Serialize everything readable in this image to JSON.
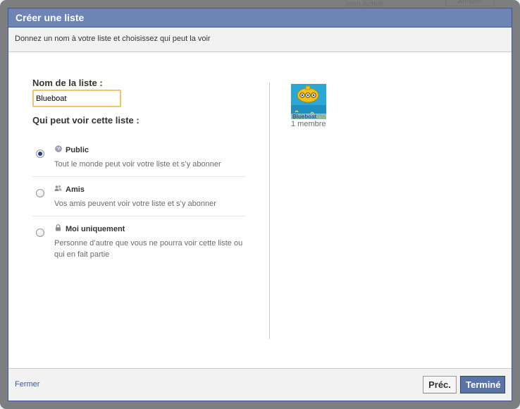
{
  "background": {
    "ghost_name": "Jean Activit",
    "ghost_button": "Annuler"
  },
  "dialog": {
    "title": "Créer une liste",
    "subtitle": "Donnez un nom à votre liste et choisissez qui peut la voir"
  },
  "form": {
    "name_label": "Nom de la liste :",
    "name_value": "Blueboat",
    "visibility_label": "Qui peut voir cette liste :",
    "options": [
      {
        "title": "Public",
        "description": "Tout le monde peut voir votre liste et s’y abonner",
        "icon": "globe-icon",
        "selected": true
      },
      {
        "title": "Amis",
        "description": "Vos amis peuvent voir votre liste et s’y abonner",
        "icon": "friends-icon",
        "selected": false
      },
      {
        "title": "Moi uniquement",
        "description": "Personne d’autre que vous ne pourra voir cette liste ou qui en fait partie",
        "icon": "lock-icon",
        "selected": false
      }
    ]
  },
  "members": {
    "thumbnail_caption": "Blueboat",
    "count": "1 membre"
  },
  "footer": {
    "close_label": "Fermer",
    "prev_label": "Préc.",
    "done_label": "Terminé"
  },
  "colors": {
    "header_bg": "#6d84b4",
    "brand_border": "#3b5998",
    "input_focus_border": "#f2c46a",
    "link": "#3b5998"
  }
}
